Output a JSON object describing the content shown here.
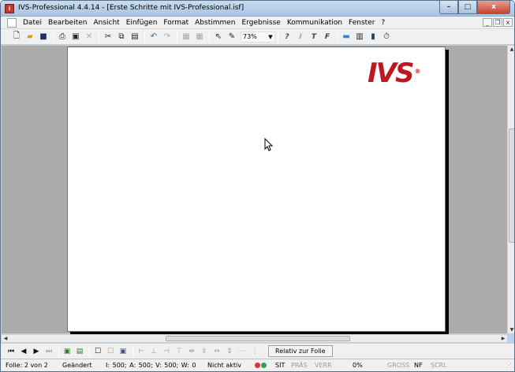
{
  "window": {
    "title": "IVS-Professional 4.4.14 - [Erste Schritte mit IVS-Professional.isf]",
    "app_icon": "ivs-app-icon",
    "caption_buttons": {
      "minimize": "–",
      "maximize": "□",
      "close": "x"
    }
  },
  "menu": {
    "items": [
      "Datei",
      "Bearbeiten",
      "Ansicht",
      "Einfügen",
      "Format",
      "Abstimmen",
      "Ergebnisse",
      "Kommunikation",
      "Fenster",
      "?"
    ],
    "mdi_buttons": [
      "_",
      "ð",
      "x"
    ]
  },
  "toolbar": {
    "icons": [
      "new-file-icon",
      "open-folder-icon",
      "save-disk-icon",
      "print-icon",
      "properties-icon",
      "delete-icon",
      "cut-icon",
      "copy-icon",
      "paste-icon",
      "undo-icon",
      "redo-icon",
      "bring-front-icon",
      "send-back-icon",
      "pointer-icon",
      "pen-icon"
    ],
    "zoom_value": "73%",
    "format_glyphs": [
      "?",
      "I",
      "T",
      "F"
    ]
  },
  "slide": {
    "logo_text": "IVS",
    "logo_mark": "®",
    "logo_color": "#c01620"
  },
  "bottom_toolbar": {
    "nav_icons": [
      "first-slide-icon",
      "prev-slide-icon",
      "next-slide-icon",
      "last-slide-icon"
    ],
    "relative_button": "Relativ zur Folie"
  },
  "statusbar": {
    "folie": "Folie: 2 von 2",
    "changed": "Geändert",
    "coords": "I: 500;  A: 500;  V: 500;  W: 0",
    "active": "Nicht aktiv",
    "sit": "SIT",
    "pras": "PRÄS",
    "verr": "VERR",
    "percent": "0%",
    "gross": "GROSS",
    "nf": "NF",
    "scrl": "SCRL",
    "status_colors": {
      "red": "#e03030",
      "green": "#2fa34a"
    }
  },
  "scrollbars": {
    "vertical_position": 0.29,
    "horizontal_position": 0.33
  }
}
